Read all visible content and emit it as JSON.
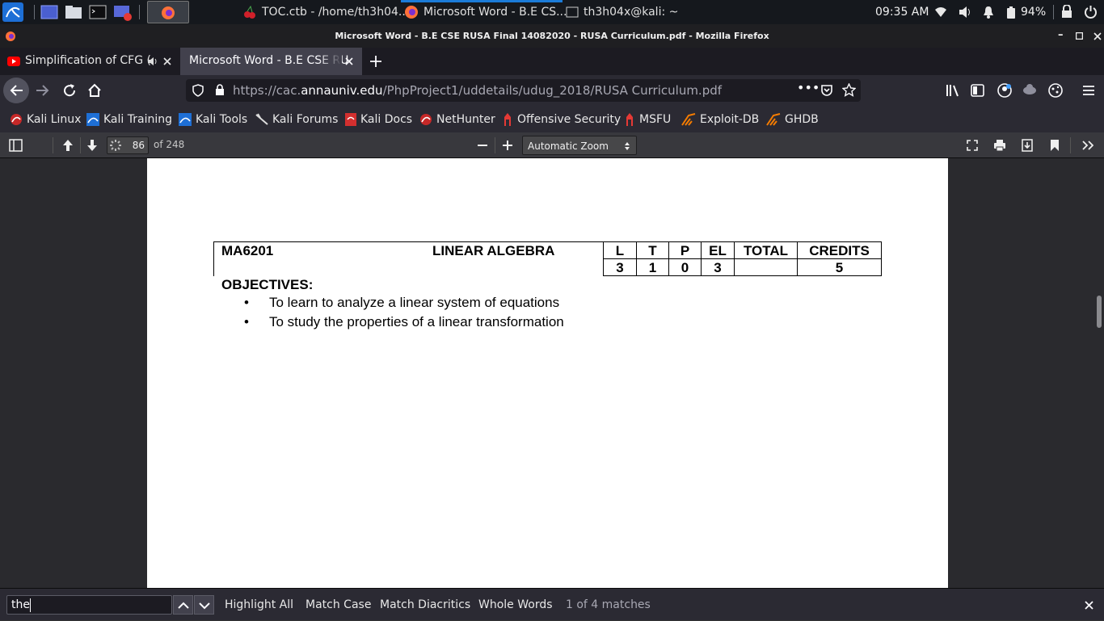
{
  "taskbar": {
    "tasks": [
      "TOC.ctb - /home/th3h04...",
      "Microsoft Word - B.E CS...",
      "th3h04x@kali: ~"
    ],
    "time": "09:35 AM",
    "battery": "94%"
  },
  "window": {
    "title": "Microsoft Word - B.E CSE RUSA Final 14082020 - RUSA Curriculum.pdf - Mozilla Firefox"
  },
  "tabs": [
    {
      "label": "Simplification of CFG (",
      "icon": "youtube-icon",
      "audio": true
    },
    {
      "label": "Microsoft Word - B.E CSE RU",
      "icon": "none"
    }
  ],
  "url": {
    "prefix": "https://cac.",
    "domain": "annauniv.edu",
    "path": "/PhpProject1/uddetails/udug_2018/RUSA Curriculum.pdf"
  },
  "bookmarks": [
    "Kali Linux",
    "Kali Training",
    "Kali Tools",
    "Kali Forums",
    "Kali Docs",
    "NetHunter",
    "Offensive Security",
    "MSFU",
    "Exploit-DB",
    "GHDB"
  ],
  "pdf": {
    "page_number": "86",
    "page_count": "of 248",
    "zoom": "Automatic Zoom"
  },
  "document": {
    "course_code": "MA6201",
    "course_title": "LINEAR ALGEBRA",
    "headers": [
      "L",
      "T",
      "P",
      "EL",
      "TOTAL",
      "CREDITS"
    ],
    "values": [
      "3",
      "1",
      "0",
      "3",
      "",
      "5"
    ],
    "objectives_heading": "OBJECTIVES:",
    "objectives": [
      "To learn to analyze a linear system of equations",
      "To study the properties of a linear transformation"
    ]
  },
  "findbar": {
    "query": "the",
    "highlight_all": "Highlight All",
    "match_case": "Match Case",
    "match_diacritics": "Match Diacritics",
    "whole_words": "Whole Words",
    "result": "1 of 4 matches"
  }
}
